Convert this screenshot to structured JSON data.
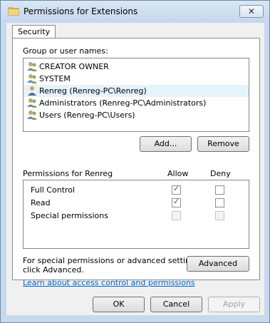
{
  "window": {
    "title": "Permissions for Extensions",
    "close_label": "✕"
  },
  "tabs": [
    {
      "label": "Security"
    }
  ],
  "group_section": {
    "label": "Group or user names:",
    "items": [
      {
        "name": "CREATOR OWNER",
        "icon": "users-group-icon"
      },
      {
        "name": "SYSTEM",
        "icon": "users-group-icon"
      },
      {
        "name": "Renreg (Renreg-PC\\Renreg)",
        "icon": "user-icon",
        "selected": true
      },
      {
        "name": "Administrators (Renreg-PC\\Administrators)",
        "icon": "users-group-icon"
      },
      {
        "name": "Users (Renreg-PC\\Users)",
        "icon": "users-group-icon"
      }
    ],
    "add_label": "Add...",
    "remove_label": "Remove"
  },
  "permissions": {
    "label": "Permissions for Renreg",
    "allow_label": "Allow",
    "deny_label": "Deny",
    "rows": [
      {
        "name": "Full Control",
        "allow": true,
        "deny": false,
        "enabled": true
      },
      {
        "name": "Read",
        "allow": true,
        "deny": false,
        "enabled": true
      },
      {
        "name": "Special permissions",
        "allow": false,
        "deny": false,
        "enabled": false
      }
    ]
  },
  "special": {
    "text_line1": "For special permissions or advanced settings,",
    "text_line2": "click Advanced.",
    "advanced_label": "Advanced"
  },
  "link": {
    "text": "Learn about access control and permissions"
  },
  "footer": {
    "ok_label": "OK",
    "cancel_label": "Cancel",
    "apply_label": "Apply"
  },
  "colors": {
    "accent": "#0066cc",
    "selected_row": "#e5f3fb",
    "frame": "#c7d9ec"
  }
}
